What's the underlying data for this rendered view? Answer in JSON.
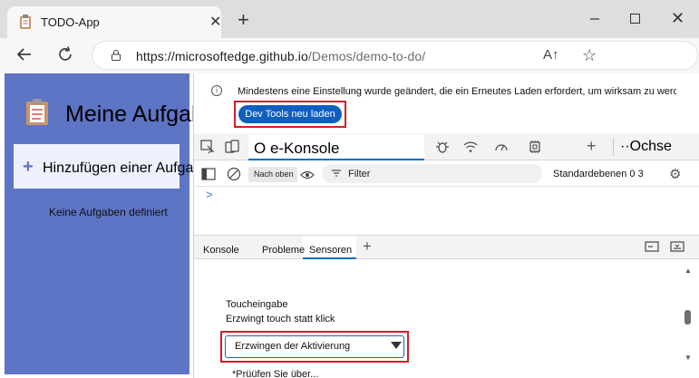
{
  "browser": {
    "tab_title": "TODO-App",
    "url_domain": "https://microsoftedge.github.io",
    "url_path": "/Demos/demo-to-do/",
    "read_aloud_label": "A↑",
    "favorite_label": "☆"
  },
  "app": {
    "title": "Meine Aufgaben",
    "add_label": "Hinzufügen einer Aufgabe",
    "empty_text": "Keine Aufgaben definiert"
  },
  "devtools": {
    "info_message": "Mindestens eine Einstellung wurde geändert, die ein Erneutes Laden erfordert, um wirksam zu werden.",
    "reload_button": "Dev Tools neu laden",
    "active_tab": "O e-Konsole",
    "more_tabs": "··Ochse",
    "levels_button": "Nach oben",
    "filter_placeholder": "Filter",
    "levels_right": "Standardebenen 0 3",
    "prompt": ">",
    "drawer_tabs": [
      "Konsole",
      "Probleme",
      "Sensoren"
    ],
    "touch_label": "Toucheingabe",
    "touch_desc": "Erzwingt touch statt klick",
    "touch_select_value": "Erzwingen der Aktivierung",
    "cut_text": "*Prüüfen Sie über..."
  },
  "colors": {
    "app_bg": "#5e74c4",
    "accent": "#0f6cbd",
    "highlight": "#d01f2c"
  }
}
